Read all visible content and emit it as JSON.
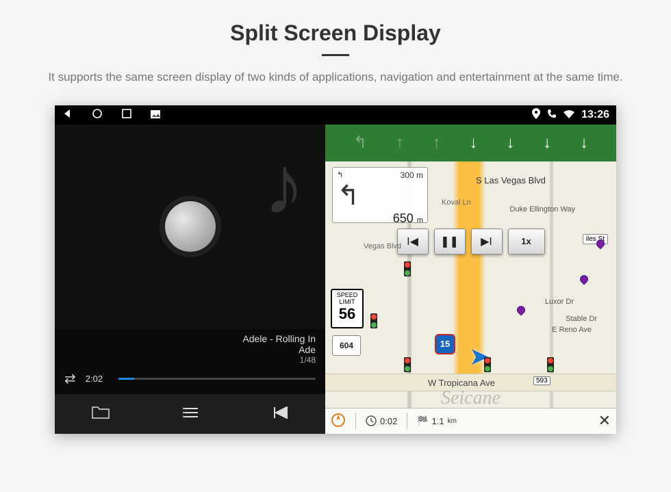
{
  "title": "Split Screen Display",
  "subtitle": "It supports the same screen display of two kinds of applications, navigation and entertainment at the same time.",
  "statusbar": {
    "time": "13:26"
  },
  "music": {
    "track_title": "Adele - Rolling In",
    "track_artist": "Ade",
    "track_index": "1/48",
    "elapsed": "2:02"
  },
  "nav": {
    "turn_next_dist": "300",
    "turn_next_unit": "m",
    "turn_dist": "650",
    "turn_unit": "m",
    "speed_label": "SPEED LIMIT",
    "speed_value": "56",
    "route_sign": "604",
    "interstate": "15",
    "playback_speed": "1x",
    "streets": {
      "main": "S Las Vegas Blvd",
      "koval": "Koval Ln",
      "duke": "Duke Ellington Way",
      "vegas2": "Vegas Blvd",
      "luxor": "Luxor Dr",
      "stable": "Stable Dr",
      "reno": "E Reno Ave",
      "tropicana": "W Tropicana Ave",
      "tropicana_tag": "593"
    },
    "miles_sign": "iles St",
    "bottom": {
      "time": "0:02",
      "dist": "1.1",
      "dist_unit": "km"
    }
  },
  "watermark": "Seicane"
}
